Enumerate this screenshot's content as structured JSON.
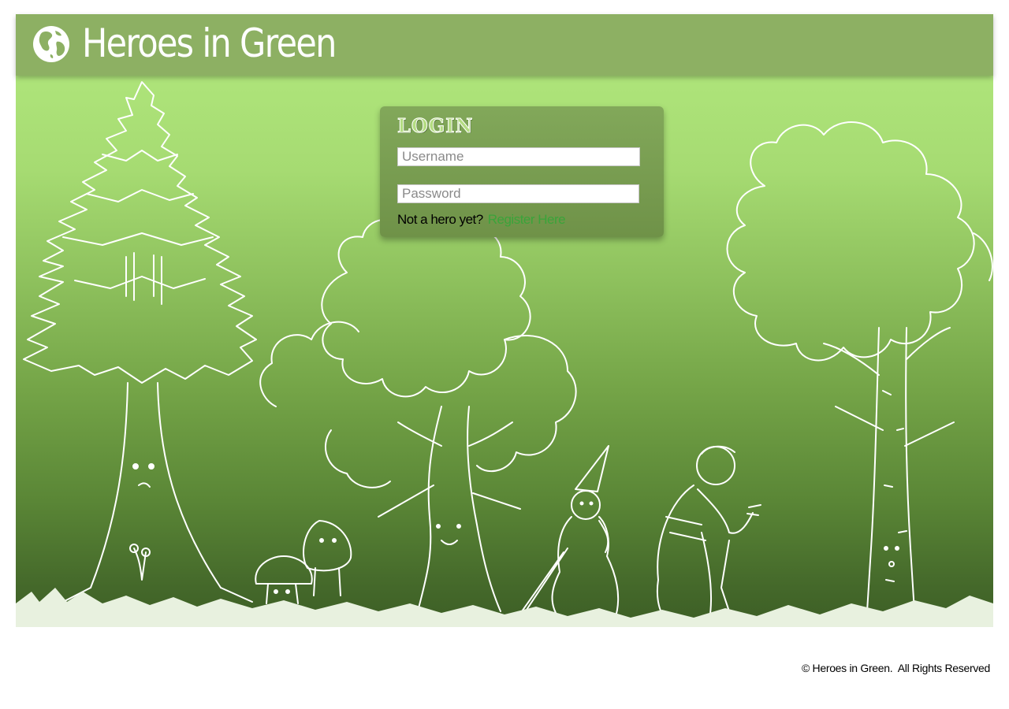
{
  "header": {
    "title": "Heroes in Green",
    "logo_icon": "globe-icon"
  },
  "login": {
    "title": "LOGIN",
    "username_placeholder": "Username",
    "password_placeholder": "Password",
    "register_prompt": "Not a hero yet?",
    "register_link": "Register Here"
  },
  "footer": {
    "copyright": "© Heroes in Green.  All Rights Reserved"
  },
  "colors": {
    "header_bg": "#8db063",
    "scene_top": "#aee47a",
    "scene_bottom": "#3c5e25",
    "link": "#3aa43a"
  },
  "illustration": {
    "elements": [
      "pine-tree",
      "mushrooms",
      "smiling-tree",
      "gnome-girl",
      "old-woman",
      "birch-tree",
      "grass"
    ]
  }
}
